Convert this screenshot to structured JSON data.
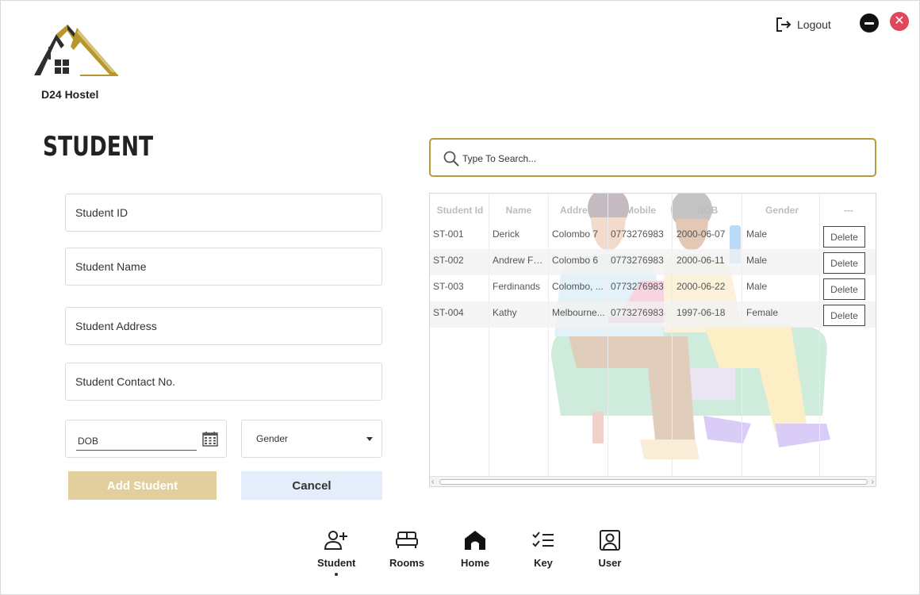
{
  "app": {
    "brand": "D24 Hostel"
  },
  "header": {
    "logout_label": "Logout"
  },
  "page": {
    "title": "STUDENT"
  },
  "form": {
    "student_id_placeholder": "Student ID",
    "student_name_placeholder": "Student Name",
    "student_address_placeholder": "Student Address",
    "student_contact_placeholder": "Student Contact No.",
    "dob_placeholder": "DOB",
    "gender_selected": "Gender",
    "add_button": "Add Student",
    "cancel_button": "Cancel"
  },
  "search": {
    "placeholder": "Type To Search..."
  },
  "table": {
    "columns": [
      "Student Id",
      "Name",
      "Address",
      "Mobile",
      "DOB",
      "Gender",
      "---"
    ],
    "rows": [
      {
        "id": "ST-001",
        "name": "Derick",
        "address": "Colombo 7",
        "mobile": "0773276983",
        "dob": "2000-06-07",
        "gender": "Male",
        "action": "Delete"
      },
      {
        "id": "ST-002",
        "name": "Andrew Fe...",
        "address": "Colombo 6",
        "mobile": "0773276983",
        "dob": "2000-06-11",
        "gender": "Male",
        "action": "Delete"
      },
      {
        "id": "ST-003",
        "name": "Ferdinands",
        "address": "Colombo, ...",
        "mobile": "0773276983",
        "dob": "2000-06-22",
        "gender": "Male",
        "action": "Delete"
      },
      {
        "id": "ST-004",
        "name": "Kathy",
        "address": "Melbourne...",
        "mobile": "0773276983",
        "dob": "1997-06-18",
        "gender": "Female",
        "action": "Delete"
      }
    ]
  },
  "nav": {
    "items": [
      {
        "label": "Student",
        "icon": "add-user-icon",
        "active": true
      },
      {
        "label": "Rooms",
        "icon": "bed-icon",
        "active": false
      },
      {
        "label": "Home",
        "icon": "home-icon",
        "active": false
      },
      {
        "label": "Key",
        "icon": "checklist-icon",
        "active": false
      },
      {
        "label": "User",
        "icon": "user-icon",
        "active": false
      }
    ]
  },
  "colors": {
    "accent_gold": "#b89a3a",
    "add_button": "#e2cf9e",
    "cancel_button": "#e4eefb",
    "close_button": "#e0475a"
  }
}
